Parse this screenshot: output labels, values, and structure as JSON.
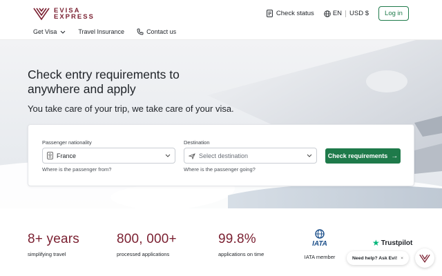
{
  "brand": {
    "line1": "EVISA",
    "line2": "EXPRESS",
    "color": "#7a1f30"
  },
  "header": {
    "check_status": "Check status",
    "language": "EN",
    "currency": "USD $",
    "login": "Log in"
  },
  "nav": {
    "get_visa": "Get Visa",
    "travel_insurance": "Travel Insurance",
    "contact_us": "Contact us"
  },
  "hero": {
    "title": "Check entry requirements to anywhere and apply",
    "subtitle": "You take care of your trip, we take care of your visa."
  },
  "search": {
    "nationality": {
      "label": "Passenger nationality",
      "value": "France",
      "help": "Where is the passenger from?"
    },
    "destination": {
      "label": "Destination",
      "placeholder": "Select destination",
      "help": "Where is the passenger going?"
    },
    "button": "Check requirements",
    "button_arrow": "→",
    "accent": "#1e7a4a"
  },
  "stats": [
    {
      "value": "8+ years",
      "label": "simplifying travel"
    },
    {
      "value": "800, 000+",
      "label": "processed applications"
    },
    {
      "value": "99.8%",
      "label": "applications on time"
    }
  ],
  "iata": {
    "logo_text": "IATA",
    "label": "IATA member"
  },
  "trustpilot": {
    "label": "Trustpilot"
  },
  "chat": {
    "text": "Need help? Ask Evi!",
    "close": "×"
  }
}
